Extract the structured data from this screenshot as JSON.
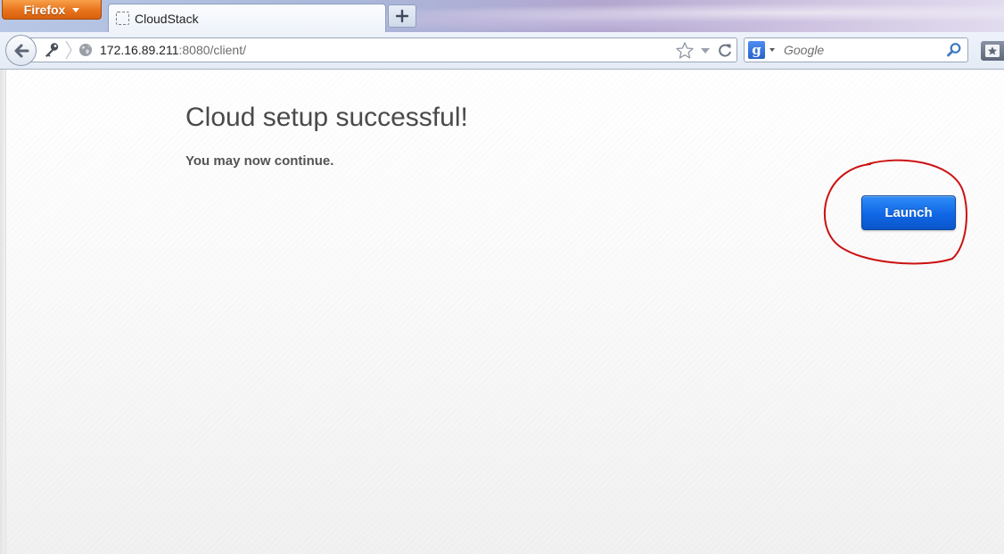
{
  "browser": {
    "menu_button_label": "Firefox",
    "tab": {
      "title": "CloudStack"
    },
    "new_tab_label": "+",
    "address": {
      "host": "172.16.89.211",
      "rest": ":8080/client/"
    },
    "search": {
      "placeholder": "Google",
      "engine_logo": "g"
    }
  },
  "page": {
    "heading": "Cloud setup successful!",
    "subtext": "You may now continue.",
    "launch_button_label": "Launch"
  },
  "colors": {
    "launch_button": "#1067e6",
    "annotation": "#cc1111",
    "firefox_button": "#e8731b"
  },
  "icons": [
    "back-arrow-icon",
    "identity-key-icon",
    "globe-icon",
    "bookmark-star-icon",
    "history-dropdown-icon",
    "reload-icon",
    "search-magnifier-icon",
    "bookmarks-icon"
  ]
}
